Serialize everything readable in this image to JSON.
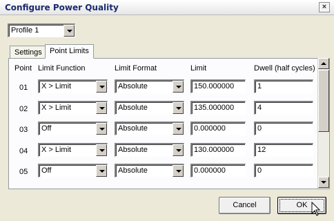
{
  "window": {
    "title": "Configure Power Quality",
    "close_glyph": "×"
  },
  "profile_select": {
    "value": "Profile 1"
  },
  "tabs": [
    {
      "label": "Settings",
      "active": false
    },
    {
      "label": "Point Limits",
      "active": true
    }
  ],
  "table": {
    "headers": [
      "Point",
      "Limit Function",
      "Limit Format",
      "Limit",
      "Dwell (half cycles)"
    ],
    "rows": [
      {
        "point": "01",
        "function": "X > Limit",
        "format": "Absolute",
        "limit": "150.000000",
        "dwell": "1"
      },
      {
        "point": "02",
        "function": "X > Limit",
        "format": "Absolute",
        "limit": "135.000000",
        "dwell": "4"
      },
      {
        "point": "03",
        "function": "Off",
        "format": "Absolute",
        "limit": "0.000000",
        "dwell": "0"
      },
      {
        "point": "04",
        "function": "X > Limit",
        "format": "Absolute",
        "limit": "130.000000",
        "dwell": "12"
      },
      {
        "point": "05",
        "function": "Off",
        "format": "Absolute",
        "limit": "0.000000",
        "dwell": "0"
      }
    ]
  },
  "buttons": {
    "cancel": "Cancel",
    "ok": "OK"
  },
  "icons": {
    "close": "close-icon",
    "dropdown": "chevron-down-icon",
    "cursor": "mouse-pointer-icon"
  },
  "colors": {
    "title_text": "#1a2a70",
    "dialog_bg": "#ece9d8",
    "panel_bg": "#fcfcfe"
  }
}
